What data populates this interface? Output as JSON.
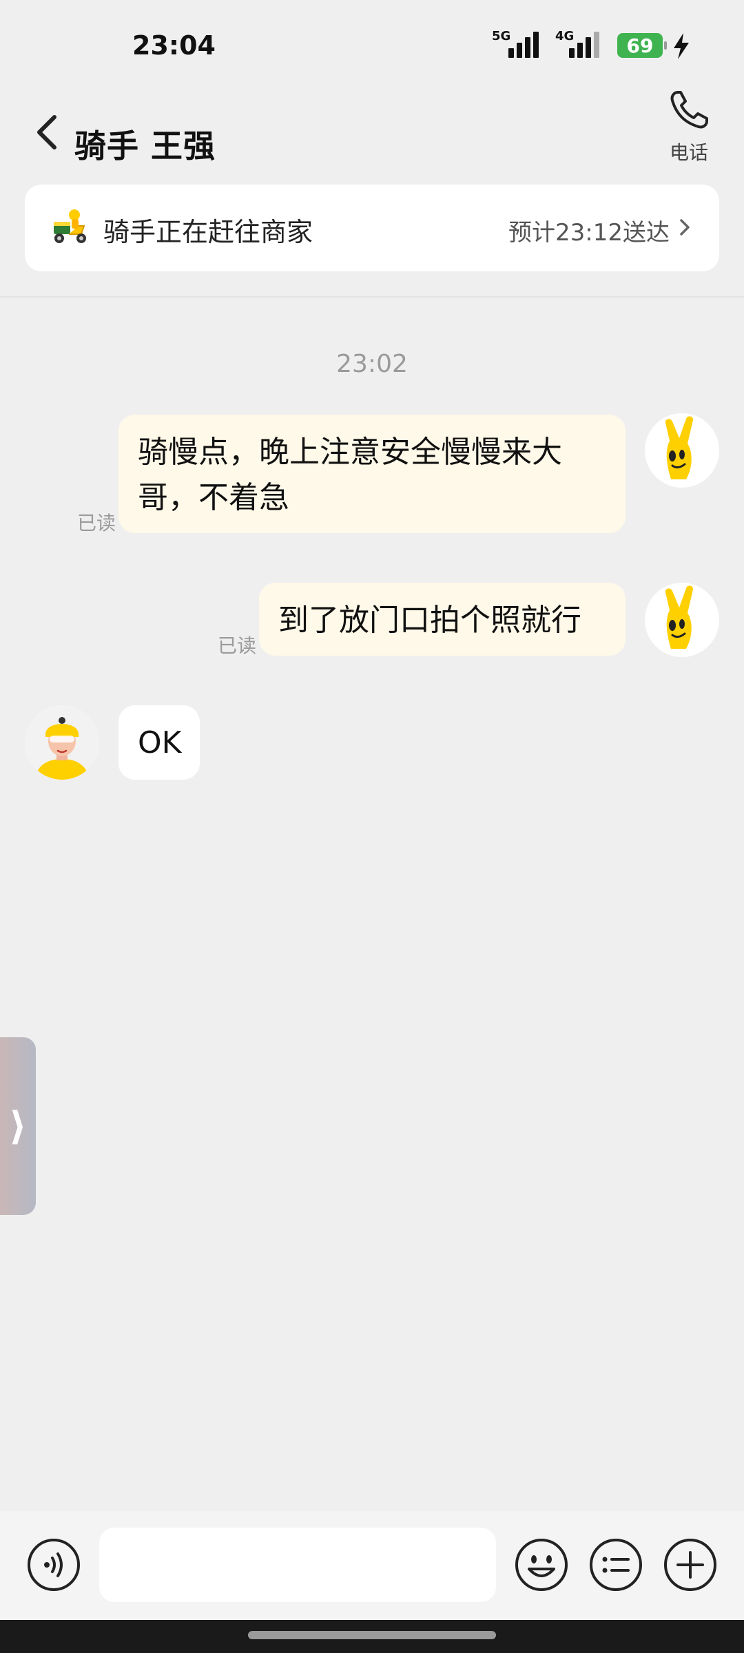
{
  "status_bar": {
    "time": "23:04",
    "network_1": "5G",
    "network_2": "4G",
    "battery": "69"
  },
  "header": {
    "title": "骑手 王强",
    "phone_label": "电话"
  },
  "delivery": {
    "status": "骑手正在赶往商家",
    "eta": "预计23:12送达"
  },
  "chat": {
    "timestamp": "23:02",
    "messages": [
      {
        "from": "me",
        "text": "骑慢点，晚上注意安全慢慢来大\n哥，不着急",
        "read": "已读"
      },
      {
        "from": "me",
        "text": "到了放门口拍个照就行",
        "read": "已读"
      },
      {
        "from": "rider",
        "text": "OK"
      }
    ]
  },
  "input": {
    "placeholder": ""
  },
  "colors": {
    "outgoing_bubble": "#fff9e9",
    "accent_yellow": "#ffd000",
    "battery_green": "#3fb34f"
  },
  "icons": {
    "back": "chevron-left-icon",
    "phone": "phone-icon",
    "scooter": "scooter-icon",
    "voice": "voice-icon",
    "emoji": "emoji-icon",
    "quick_reply": "list-icon",
    "more": "plus-icon"
  }
}
